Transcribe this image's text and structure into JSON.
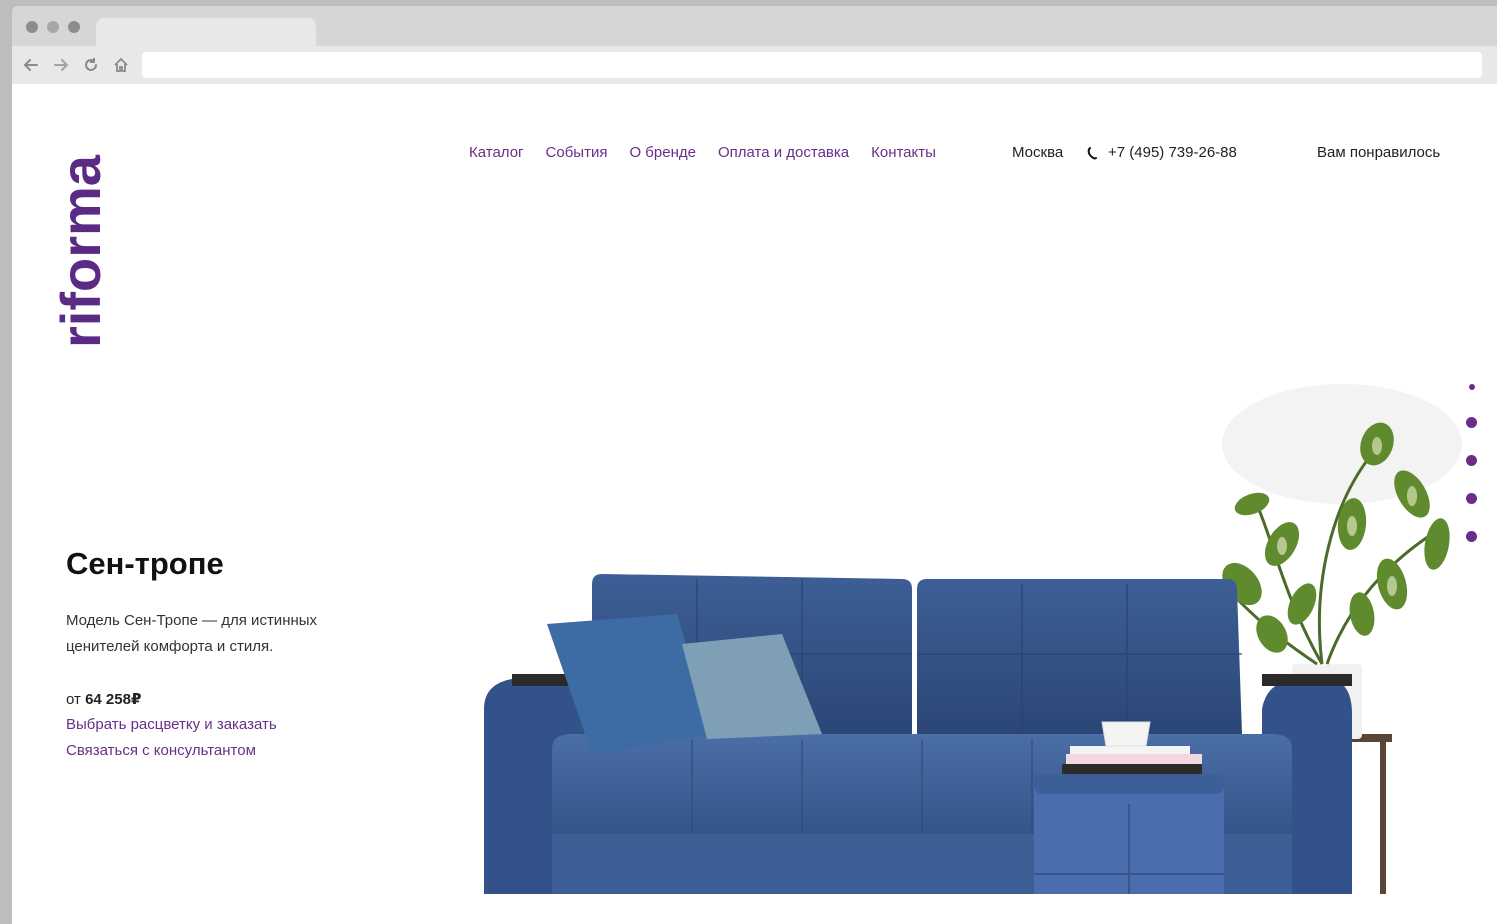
{
  "brand": {
    "logo_text": "riforma",
    "accent_color": "#6a2e8a"
  },
  "nav": {
    "items": [
      "Каталог",
      "События",
      "О бренде",
      "Оплата и доставка",
      "Контакты"
    ]
  },
  "header": {
    "city": "Москва",
    "phone": "+7 (495) 739-26-88",
    "favorites": "Вам понравилось"
  },
  "hero": {
    "title": "Сен-тропе",
    "description": "Модель Сен-Тропе — для истинных ценителей комфорта и стиля.",
    "price_prefix": "от",
    "price_value": "64 258₽",
    "cta_order": "Выбрать расцветку и заказать",
    "cta_consult": "Связаться с консультантом"
  },
  "slider": {
    "count": 5,
    "active_index": 0
  }
}
